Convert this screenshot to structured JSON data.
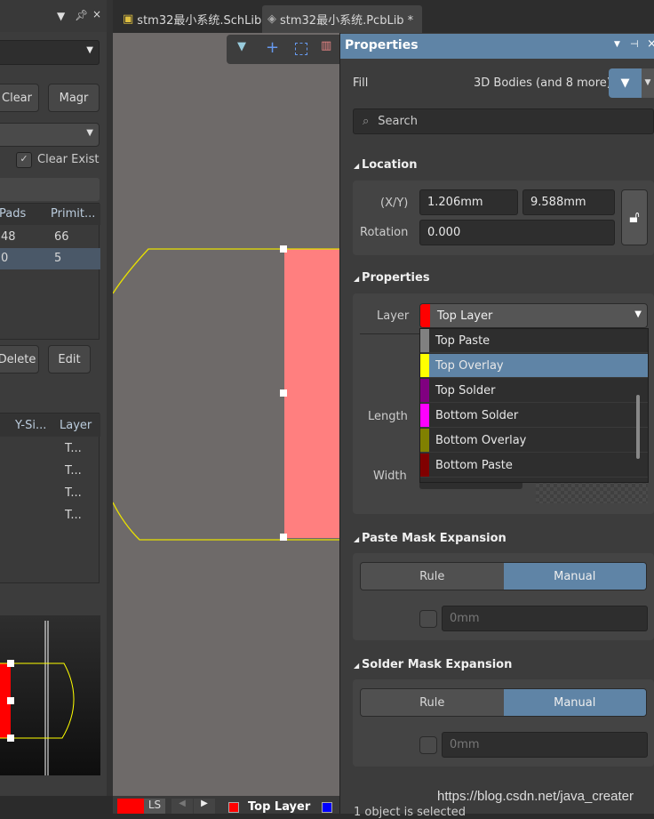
{
  "tabs": [
    {
      "label": "stm32最小系统.SchLib",
      "active": false
    },
    {
      "label": "stm32最小系统.PcbLib *",
      "active": true
    }
  ],
  "left_panel": {
    "clear_button": "Clear",
    "magnify_button": "Magr",
    "delete_button": "Delete",
    "edit_button": "Edit",
    "clear_existing_label": "Clear Exist",
    "clear_existing_checked": true,
    "component_table": {
      "headers": [
        "Pads",
        "Primit..."
      ],
      "rows": [
        [
          "48",
          "66"
        ],
        [
          "0",
          "5"
        ]
      ],
      "selected_row": 1
    },
    "primitive_table": {
      "headers": [
        "Y-Si...",
        "Layer"
      ],
      "rows": [
        [
          "",
          "T..."
        ],
        [
          "",
          "T..."
        ],
        [
          "",
          "T..."
        ],
        [
          "",
          "T..."
        ]
      ]
    }
  },
  "status": {
    "ls_label": "LS",
    "current_layer": "Top Layer",
    "colors": {
      "top": "#ff0000",
      "bottom": "#0000ff"
    }
  },
  "properties": {
    "title": "Properties",
    "object_type": "Fill",
    "filter_text": "3D Bodies (and 8 more)",
    "search_placeholder": "Search",
    "location": {
      "title": "Location",
      "xy_label": "(X/Y)",
      "x": "1.206mm",
      "y": "9.588mm",
      "rotation_label": "Rotation",
      "rotation": "0.000"
    },
    "props": {
      "title": "Properties",
      "layer_label": "Layer",
      "layer_value": "Top Layer",
      "layer_color": "#ff0000",
      "length_label": "Length",
      "width_label": "Width",
      "layer_options": [
        {
          "label": "Top Paste",
          "color": "#808080"
        },
        {
          "label": "Top Overlay",
          "color": "#ffff00",
          "highlighted": true
        },
        {
          "label": "Top Solder",
          "color": "#800080"
        },
        {
          "label": "Bottom Solder",
          "color": "#ff00ff"
        },
        {
          "label": "Bottom Overlay",
          "color": "#808000"
        },
        {
          "label": "Bottom Paste",
          "color": "#800000"
        }
      ]
    },
    "paste_mask": {
      "title": "Paste Mask Expansion",
      "rule": "Rule",
      "manual": "Manual",
      "value_placeholder": "0mm"
    },
    "solder_mask": {
      "title": "Solder Mask Expansion",
      "rule": "Rule",
      "manual": "Manual",
      "value_placeholder": "0mm"
    },
    "footer": "1 object is selected"
  },
  "watermark": "https://blog.csdn.net/java_creater",
  "accent": "#5f84a6"
}
